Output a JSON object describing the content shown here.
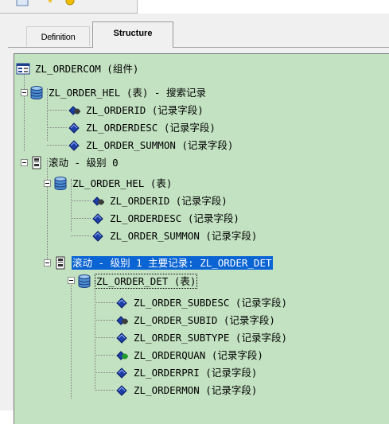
{
  "tabs": {
    "definition": "Definition",
    "structure": "Structure"
  },
  "tree": {
    "root": "ZL_ORDERCOM (组件)",
    "record1": "ZL_ORDER_HEL (表) - 搜索记录",
    "record1_fields": [
      "ZL_ORDERID (记录字段)",
      "ZL_ORDERDESC (记录字段)",
      "ZL_ORDER_SUMMON (记录字段)"
    ],
    "scroll0": "滚动 - 级别 0",
    "record2": "ZL_ORDER_HEL (表)",
    "record2_fields": [
      "ZL_ORDERID (记录字段)",
      "ZL_ORDERDESC (记录字段)",
      "ZL_ORDER_SUMMON (记录字段)"
    ],
    "scroll1": "滚动 - 级别 1 主要记录: ZL_ORDER_DET",
    "record3": "ZL_ORDER_DET (表)",
    "record3_fields": [
      "ZL_ORDER_SUBDESC (记录字段)",
      "ZL_ORDER_SUBID (记录字段)",
      "ZL_ORDER_SUBTYPE (记录字段)",
      "ZL_ORDERQUAN (记录字段)",
      "ZL_ORDERPRI (记录字段)",
      "ZL_ORDERMON (记录字段)"
    ]
  },
  "colors": {
    "tree_bg": "#c3e2c2",
    "selection": "#0a64d4"
  }
}
